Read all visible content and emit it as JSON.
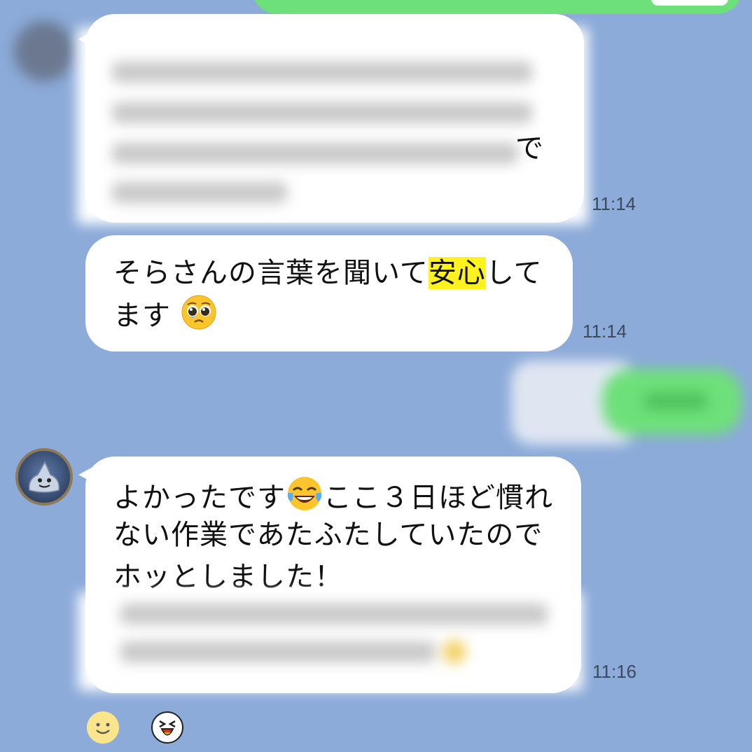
{
  "messages": [
    {
      "id": "m1",
      "text_end": "で",
      "time": "11:14"
    },
    {
      "id": "m2",
      "line1_a": "そらさんの言葉を聞いて",
      "line1_hl": "安心",
      "line1_b": "して",
      "line2": "ます",
      "emoji": "pleading-face",
      "time": "11:14"
    },
    {
      "id": "m3",
      "line1_a": "よかったです",
      "emoji": "tears-of-joy-face",
      "line1_b": "ここ３日ほど慣れ",
      "line2": "ない作業であたふたしていたので",
      "line3": "ホッとしました！",
      "time": "11:16"
    }
  ],
  "colors": {
    "background": "#8cabd9",
    "outgoing": "#6ee07a",
    "incoming": "#ffffff",
    "highlight": "#fff21e"
  },
  "reactions": [
    "smile-icon",
    "laughing-face-icon"
  ]
}
